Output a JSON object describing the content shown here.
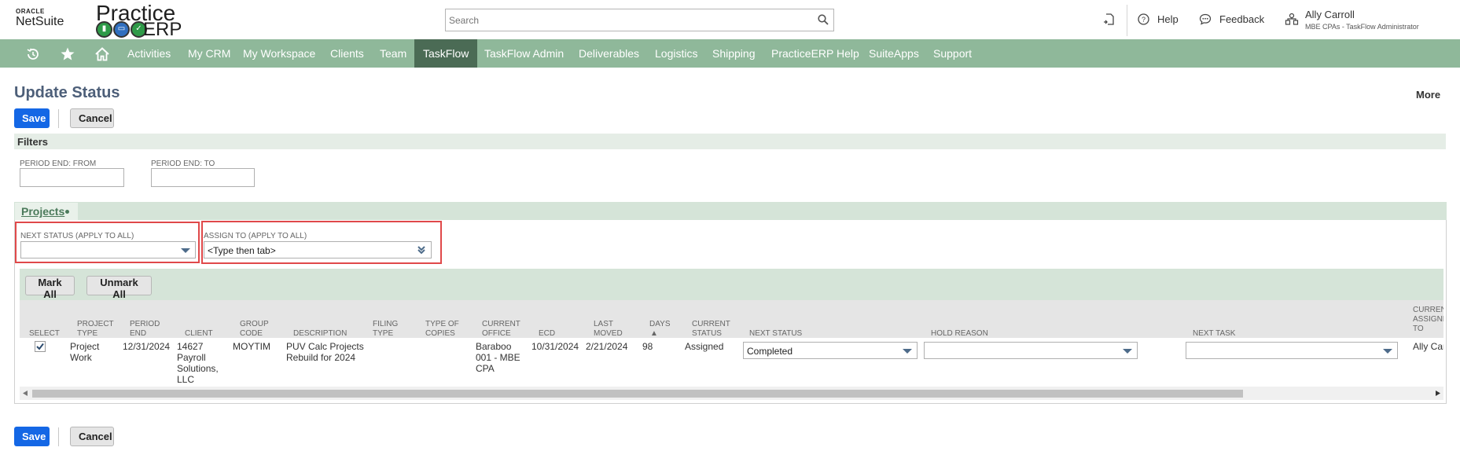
{
  "header": {
    "oracle_label": "ORACLE",
    "netsuite_label": "NetSuite",
    "practice_label": "Practice",
    "erp_label": "ERP",
    "search_placeholder": "Search",
    "help_label": "Help",
    "feedback_label": "Feedback",
    "user_name": "Ally Carroll",
    "user_role": "MBE CPAs - TaskFlow Administrator"
  },
  "nav": {
    "items": [
      "Activities",
      "My CRM",
      "My Workspace",
      "Clients",
      "Team",
      "TaskFlow",
      "TaskFlow Admin",
      "Deliverables",
      "Logistics",
      "Shipping",
      "PracticeERP Help",
      "SuiteApps",
      "Support"
    ],
    "active": "TaskFlow"
  },
  "page": {
    "title": "Update Status",
    "more_label": "More",
    "save_label": "Save",
    "cancel_label": "Cancel"
  },
  "filters": {
    "title": "Filters",
    "period_end_from_label": "PERIOD END: FROM",
    "period_end_to_label": "PERIOD END: TO",
    "period_end_from_value": "",
    "period_end_to_value": ""
  },
  "projects": {
    "tab_label": "Projects",
    "next_status_label": "NEXT STATUS (APPLY TO ALL)",
    "next_status_value": "",
    "assign_to_label": "ASSIGN TO (APPLY TO ALL)",
    "assign_to_value": "<Type then tab>",
    "mark_all_label": "Mark All",
    "unmark_all_label": "Unmark All",
    "columns": {
      "select": "SELECT",
      "project_type": [
        "PROJECT",
        "TYPE"
      ],
      "period_end": [
        "PERIOD",
        "END"
      ],
      "client": "CLIENT",
      "group_code": [
        "GROUP",
        "CODE"
      ],
      "description": "DESCRIPTION",
      "filing_type": [
        "FILING",
        "TYPE"
      ],
      "type_of_copies": [
        "TYPE OF",
        "COPIES"
      ],
      "current_office": [
        "CURRENT",
        "OFFICE"
      ],
      "ecd": "ECD",
      "last_moved": [
        "LAST",
        "MOVED"
      ],
      "days": "DAYS",
      "days_sort": "▲",
      "current_status": [
        "CURRENT",
        "STATUS"
      ],
      "next_status": "NEXT STATUS",
      "hold_reason": "HOLD REASON",
      "next_task": "NEXT TASK",
      "current_assignee": [
        "CURRENT",
        "ASSIGNEE",
        "TO"
      ]
    },
    "rows": [
      {
        "selected": true,
        "project_type": [
          "Project",
          "Work"
        ],
        "period_end": "12/31/2024",
        "client": [
          "14627",
          "Payroll",
          "Solutions,",
          "LLC"
        ],
        "group_code": "MOYTIM",
        "description": [
          "PUV Calc Projects",
          "Rebuild for 2024"
        ],
        "filing_type": "",
        "type_of_copies": "",
        "current_office": [
          "Baraboo",
          "001 - MBE",
          "CPA"
        ],
        "ecd": "10/31/2024",
        "last_moved": "2/21/2024",
        "days": "98",
        "current_status": "Assigned",
        "next_status": "Completed",
        "hold_reason": "",
        "next_task": "",
        "current_assignee": "Ally Carroll"
      }
    ]
  },
  "colors": {
    "nav_bg": "#8fb89a",
    "nav_active": "#4b6b55",
    "primary_button": "#1467e5",
    "title_color": "#4d5f79",
    "highlight_box": "#e0494a"
  }
}
